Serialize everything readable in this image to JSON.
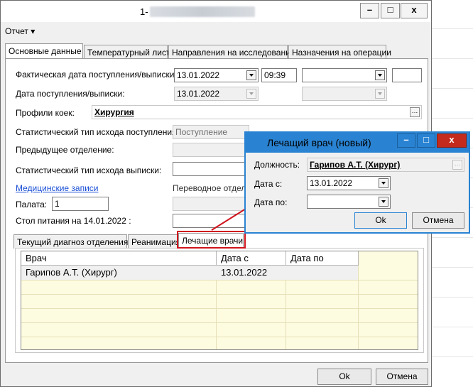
{
  "window": {
    "title": "1-",
    "minimize_symbol": "–",
    "maximize_symbol": "□",
    "close_symbol": "x"
  },
  "menu": {
    "report_label": "Отчет ▾"
  },
  "tabs": [
    {
      "label": "Основные данные"
    },
    {
      "label": "Температурный лист"
    },
    {
      "label": "Направления на исследования"
    },
    {
      "label": "Назначения на операции"
    }
  ],
  "form": {
    "actual_date_label": "Фактическая дата поступления/выписки:",
    "actual_date_value": "13.01.2022",
    "actual_time_value": "09:39",
    "date_label": "Дата поступления/выписки:",
    "date_value": "13.01.2022",
    "bed_profiles_label": "Профили коек:",
    "bed_profiles_value": "Хирургия",
    "stat_admission_label": "Статистический тип исхода поступления:",
    "stat_admission_value": "Поступление",
    "prev_department_label": "Предыдущее отделение:",
    "stat_discharge_label": "Статистический тип исхода выписки:",
    "medical_records_link": "Медицинские записи",
    "transfer_department_label": "Переводное отделе",
    "ward_label": "Палата:",
    "ward_value": "1",
    "diet_label": "Стол питания на 14.01.2022 :"
  },
  "subtabs": [
    {
      "label": "Текущий диагноз отделения"
    },
    {
      "label": "Реанимация"
    },
    {
      "label": "Лечащие врачи"
    }
  ],
  "grid": {
    "columns": [
      "Врач",
      "Дата с",
      "Дата по"
    ],
    "rows": [
      {
        "doctor": "Гарипов А.Т. (Хирург)",
        "date_from": "13.01.2022",
        "date_to": ""
      }
    ]
  },
  "buttons": {
    "ok": "Ok",
    "cancel": "Отмена"
  },
  "dialog": {
    "title": "Лечащий врач (новый)",
    "position_label": "Должность:",
    "position_value": "Гарипов А.Т. (Хирург)",
    "date_from_label": "Дата с:",
    "date_from_value": "13.01.2022",
    "date_to_label": "Дата по:",
    "date_to_value": "",
    "ok": "Ok",
    "cancel": "Отмена"
  },
  "colors": {
    "dialog_title": "#2a83d2",
    "close_button": "#c42b1c",
    "highlight": "#d0141c",
    "link": "#1a4fd6",
    "grid_background": "#fdfbe0"
  }
}
